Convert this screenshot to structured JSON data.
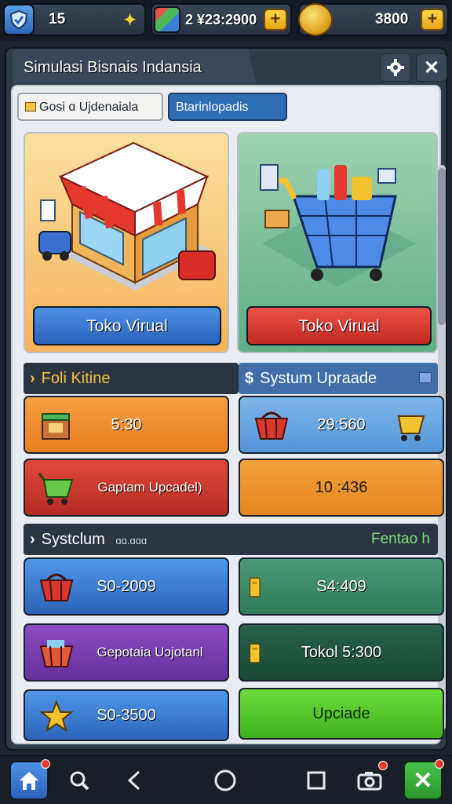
{
  "top_bar": {
    "level": "15",
    "cash": "2 ¥23:2900",
    "coins": "3800"
  },
  "window": {
    "title": "Simulasi Bisnais Indansia",
    "tabs": [
      {
        "label": "Gosi ɑ Ujdenaiala"
      },
      {
        "label": "Btarinlopadis"
      }
    ]
  },
  "stores": [
    {
      "label": "Toko Virual"
    },
    {
      "label": "Toko Virual"
    }
  ],
  "sections": {
    "left_header": "Foli Kitine",
    "right_header": "Systum Upraade",
    "lower_header": "Systclum",
    "lower_header_sub": "ɑɑ.ɑɑɑ",
    "lower_header_right": "Fentao h"
  },
  "tiles": {
    "row1_left": "5:30",
    "row1_right": "29:560",
    "row2_left": "Gaptam Upcadel)",
    "row2_right": "10 :436",
    "row3_left": "S0-2009",
    "row3_right": "S4:409",
    "row4_left": "Gepotaia Uɔjotanl",
    "row4_right": "Tokol 5:300",
    "row5_left": "S0-3500",
    "row5_right": "Upciade"
  },
  "colors": {
    "accent_blue": "#2f6db4",
    "accent_red": "#d93a2e",
    "accent_green": "#48c24a",
    "accent_gold": "#f2c230"
  }
}
